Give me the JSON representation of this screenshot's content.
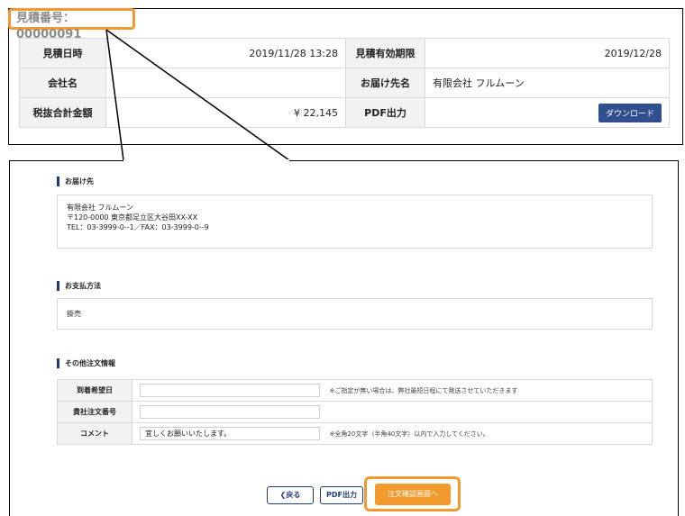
{
  "estimate": {
    "quote_number": "見積番号：00000091",
    "rows": [
      {
        "label1": "見積日時",
        "value1": "2019/11/28 13:28",
        "label2": "見積有効期限",
        "value2": "2019/12/28"
      },
      {
        "label1": "会社名",
        "value1": "",
        "label2": "お届け先名",
        "value2": "有限会社 フルムーン"
      },
      {
        "label1": "税抜合計金額",
        "value1": "¥ 22,145",
        "label2": "PDF出力",
        "value2": ""
      }
    ],
    "download_label": "ダウンロード"
  },
  "delivery": {
    "title": "お届け先",
    "lines": [
      "有限会社 フルムーン",
      "〒120-0000 東京都足立区大谷田XX-XX",
      "TEL：03-3999-0--1／FAX：03-3999-0--9"
    ]
  },
  "payment": {
    "title": "お支払方法",
    "method": "掛売"
  },
  "other": {
    "title": "その他注文情報",
    "rows": [
      {
        "label": "到着希望日",
        "value": "",
        "note": "※ご指定が無い場合は、弊社最短日程にて発送させていただきます"
      },
      {
        "label": "貴社注文番号",
        "value": "",
        "note": ""
      },
      {
        "label": "コメント",
        "value": "宜しくお願いいたします。",
        "note": "※全角20文字（半角40文字）以内で入力してください。"
      }
    ]
  },
  "buttons": {
    "back": "❮戻る",
    "pdf": "PDF出力",
    "confirm": "注文確認画面へ"
  },
  "colors": {
    "accent": "#f29a2e",
    "navy": "#1f3b77"
  }
}
